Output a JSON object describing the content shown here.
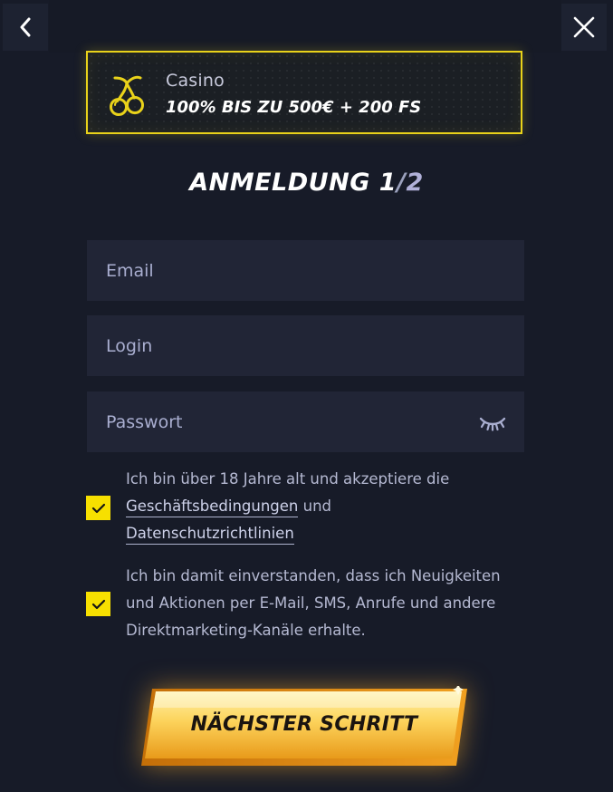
{
  "nav": {
    "back_icon": "chevron-left-icon",
    "close_icon": "close-icon"
  },
  "promo": {
    "icon": "cherries-icon",
    "category": "Casino",
    "offer": "100% BIS ZU 500€ + 200 FS",
    "accent_color": "#e9d21a"
  },
  "title": {
    "text": "ANMELDUNG",
    "step": "1",
    "separator": "/",
    "total": "2"
  },
  "form": {
    "email": {
      "placeholder": "Email",
      "value": ""
    },
    "login": {
      "placeholder": "Login",
      "value": ""
    },
    "password": {
      "placeholder": "Passwort",
      "value": "",
      "toggle_icon": "eye-closed-icon"
    }
  },
  "consents": {
    "terms": {
      "checked": true,
      "text_before": "Ich bin über 18 Jahre alt und akzeptiere die",
      "link_terms": "Geschäftsbedingungen",
      "conjunction": "und",
      "link_privacy": "Datenschutzrichtlinien"
    },
    "marketing": {
      "checked": true,
      "text": "Ich bin damit einverstanden, dass ich Neuigkeiten und Aktionen per E-Mail, SMS, Anrufe und andere Direktmarketing-Kanäle erhalte."
    },
    "check_color": "#f7e000"
  },
  "cta": {
    "label": "NÄCHSTER SCHRITT",
    "color": "#f5b820"
  },
  "colors": {
    "background": "#171b28",
    "field": "#212536"
  }
}
